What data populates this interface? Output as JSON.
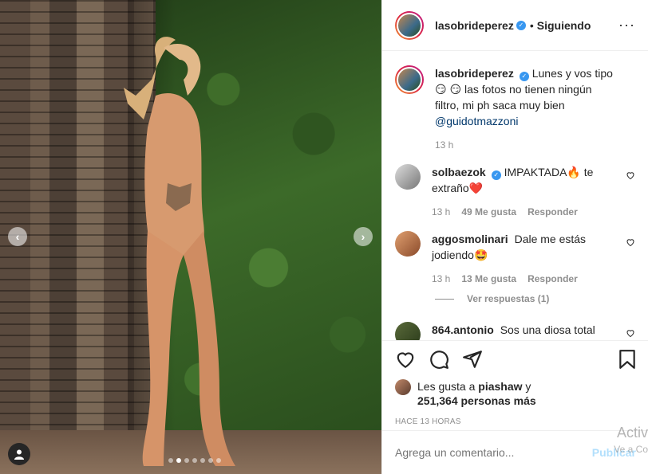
{
  "post": {
    "username": "lasobrideperez",
    "follow_status": "Siguiendo",
    "caption": "Lunes y vos tipo 😏 😏 las fotos no tienen ningún filtro, mi ph saca muy bien",
    "caption_mention": "@guidotmazzoni",
    "caption_time": "13 h"
  },
  "carousel": {
    "total": 7,
    "active_index": 1
  },
  "comments": [
    {
      "username": "solbaezok",
      "verified": true,
      "text": "IMPAKTADA🔥 te extraño❤️",
      "time": "13 h",
      "likes": "49 Me gusta",
      "reply": "Responder"
    },
    {
      "username": "aggosmolinari",
      "verified": false,
      "text": "Dale me estás jodiendo🤩",
      "time": "13 h",
      "likes": "13 Me gusta",
      "reply": "Responder",
      "view_replies": "Ver respuestas (1)"
    },
    {
      "username": "864.antonio",
      "verified": false,
      "text": "Sos una diosa total"
    }
  ],
  "likes": {
    "prefix": "Les gusta a",
    "user": "piashaw",
    "connector": "y",
    "count_text": "251,364 personas más"
  },
  "timestamp": "HACE 13 HORAS",
  "add_comment": {
    "placeholder": "Agrega un comentario...",
    "publish": "Publicar"
  },
  "watermark": {
    "line1": "Activ",
    "line2": "Ve a Co"
  },
  "colors": {
    "verified": "#3897f0",
    "publish": "#b2dffc",
    "mention": "#00376b"
  }
}
